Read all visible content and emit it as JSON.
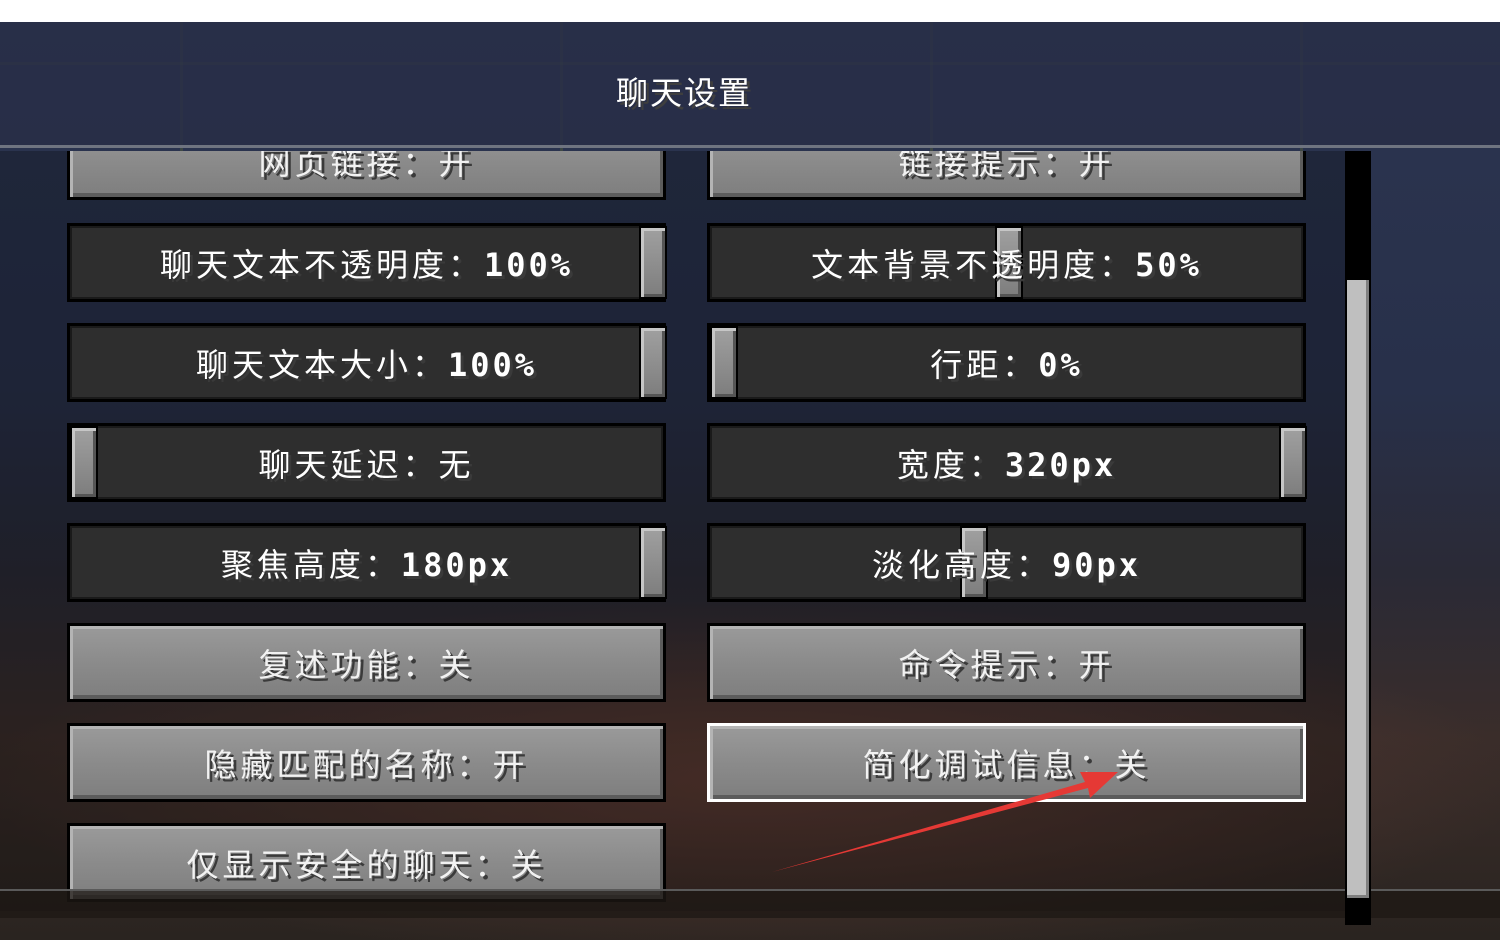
{
  "screen_title": "聊天设置",
  "options": [
    {
      "key": "web_links",
      "label": "网页链接：开",
      "kind": "button"
    },
    {
      "key": "link_prompt",
      "label": "链接提示：开",
      "kind": "button"
    },
    {
      "key": "chat_text_opacity",
      "label": "聊天文本不透明度：",
      "value": "100%",
      "kind": "slider",
      "level": 1.0
    },
    {
      "key": "text_background_opacity",
      "label": "文本背景不透明度：",
      "value": "50%",
      "kind": "slider",
      "level": 0.5
    },
    {
      "key": "chat_text_size",
      "label": "聊天文本大小：",
      "value": "100%",
      "kind": "slider",
      "level": 1.0
    },
    {
      "key": "line_spacing",
      "label": "行距：",
      "value": "0%",
      "kind": "slider",
      "level": 0.0
    },
    {
      "key": "chat_delay",
      "label": "聊天延迟：无",
      "value": "",
      "kind": "slider",
      "level": 0.0
    },
    {
      "key": "width",
      "label": "宽度：",
      "value": "320px",
      "kind": "slider",
      "level": 1.0
    },
    {
      "key": "focused_height",
      "label": "聚焦高度：",
      "value": "180px",
      "kind": "slider",
      "level": 1.0
    },
    {
      "key": "unfocused_height",
      "label": "淡化高度：",
      "value": "90px",
      "kind": "slider",
      "level": 0.44
    },
    {
      "key": "narrator",
      "label": "复述功能：关",
      "kind": "button"
    },
    {
      "key": "command_suggestions",
      "label": "命令提示：开",
      "kind": "button"
    },
    {
      "key": "hide_matched_names",
      "label": "隐藏匹配的名称：开",
      "kind": "button"
    },
    {
      "key": "reduced_debug_info",
      "label": "简化调试信息：关",
      "kind": "button",
      "focused": true
    },
    {
      "key": "only_show_secure_chat",
      "label": "仅显示安全的聊天：关",
      "kind": "button"
    }
  ],
  "scrollbar": {
    "position_fraction": 0.35
  },
  "annotation": {
    "type": "red-arrow",
    "color": "#e53935"
  }
}
